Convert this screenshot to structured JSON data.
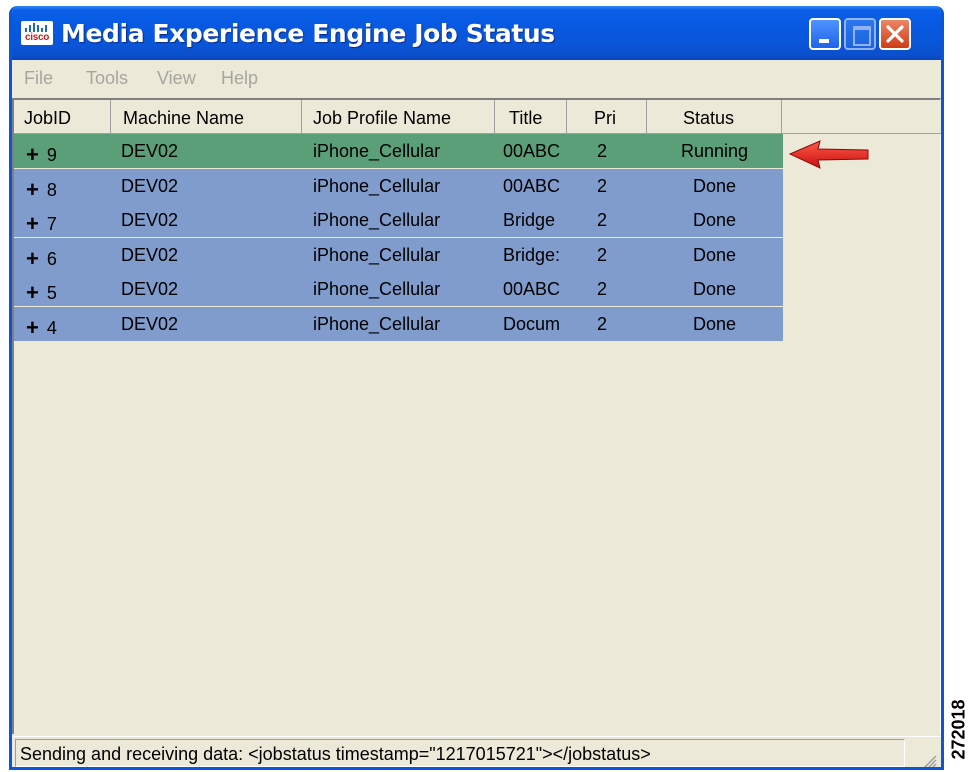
{
  "window": {
    "title": "Media Experience Engine Job Status",
    "logo_text": "cisco",
    "controls": {
      "minimize": "minimize-icon",
      "maximize": "maximize-icon",
      "close": "close-icon"
    }
  },
  "menu": [
    "File",
    "Tools",
    "View",
    "Help"
  ],
  "table": {
    "columns": [
      "JobID",
      "Machine Name",
      "Job Profile Name",
      "Title",
      "Pri",
      "Status"
    ],
    "rows": [
      {
        "expander": "+",
        "job_id": "9",
        "machine": "DEV02",
        "profile": "iPhone_Cellular",
        "title": "00ABC",
        "pri": "2",
        "status": "Running"
      },
      {
        "expander": "+",
        "job_id": "8",
        "machine": "DEV02",
        "profile": "iPhone_Cellular",
        "title": "00ABC",
        "pri": "2",
        "status": "Done"
      },
      {
        "expander": "+",
        "job_id": "7",
        "machine": "DEV02",
        "profile": "iPhone_Cellular",
        "title": "Bridge",
        "pri": "2",
        "status": "Done"
      },
      {
        "expander": "+",
        "job_id": "6",
        "machine": "DEV02",
        "profile": "iPhone_Cellular",
        "title": "Bridge:",
        "pri": "2",
        "status": "Done"
      },
      {
        "expander": "+",
        "job_id": "5",
        "machine": "DEV02",
        "profile": "iPhone_Cellular",
        "title": "00ABC",
        "pri": "2",
        "status": "Done"
      },
      {
        "expander": "+",
        "job_id": "4",
        "machine": "DEV02",
        "profile": "iPhone_Cellular",
        "title": "Docum",
        "pri": "2",
        "status": "Done"
      }
    ]
  },
  "status_bar": "Sending and receiving data: <jobstatus timestamp=\"1217015721\"></jobstatus>",
  "figure_id": "272018",
  "colors": {
    "running_row": "#5a9f78",
    "done_row": "#7f9ccc",
    "title_bar": "#0a5fe8",
    "annotation_arrow": "#e01818"
  }
}
